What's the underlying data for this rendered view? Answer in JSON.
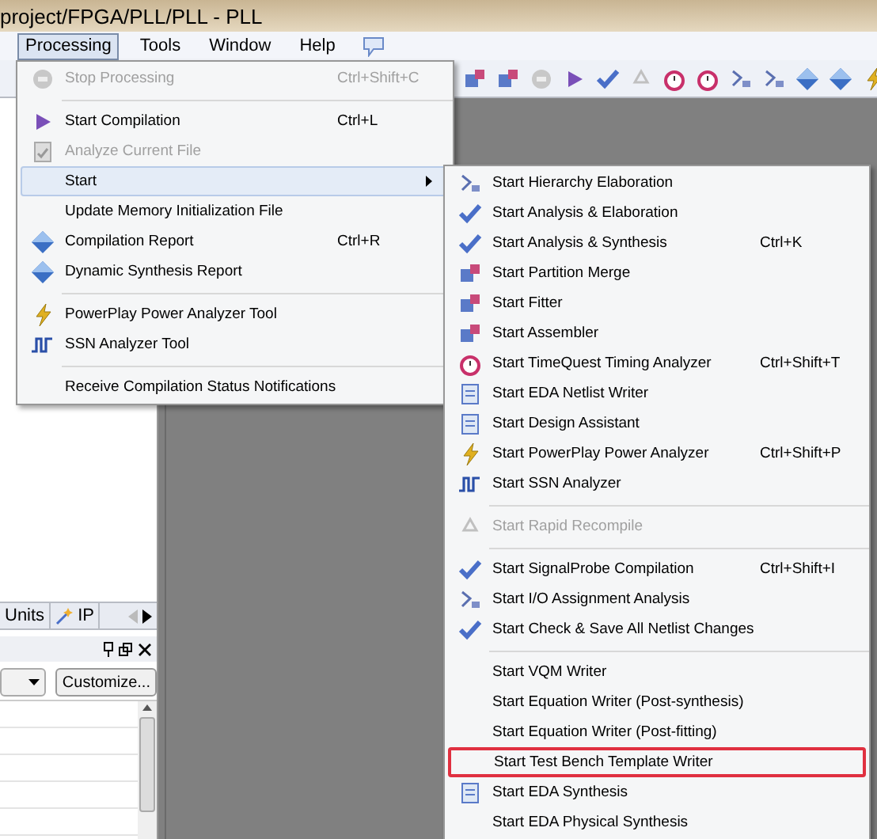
{
  "window": {
    "title": "project/FPGA/PLL/PLL - PLL"
  },
  "menubar": [
    {
      "label": "Processing",
      "selected": true
    },
    {
      "label": "Tools",
      "selected": false
    },
    {
      "label": "Window",
      "selected": false
    },
    {
      "label": "Help",
      "selected": false
    }
  ],
  "processing_menu": [
    {
      "kind": "item",
      "label": "Stop Processing",
      "shortcut": "Ctrl+Shift+C",
      "disabled": true,
      "selected": false
    },
    {
      "kind": "separator"
    },
    {
      "kind": "item",
      "label": "Start Compilation",
      "shortcut": "Ctrl+L",
      "disabled": false,
      "selected": false
    },
    {
      "kind": "item",
      "label": "Analyze Current File",
      "disabled": true,
      "selected": false
    },
    {
      "kind": "submenu",
      "label": "Start",
      "disabled": false,
      "selected": true
    },
    {
      "kind": "item",
      "label": "Update Memory Initialization File",
      "disabled": false,
      "selected": false
    },
    {
      "kind": "item",
      "label": "Compilation Report",
      "shortcut": "Ctrl+R",
      "disabled": false,
      "selected": false
    },
    {
      "kind": "item",
      "label": "Dynamic Synthesis Report",
      "disabled": false,
      "selected": false
    },
    {
      "kind": "separator"
    },
    {
      "kind": "item",
      "label": "PowerPlay Power Analyzer Tool",
      "disabled": false,
      "selected": false
    },
    {
      "kind": "item",
      "label": "SSN Analyzer Tool",
      "disabled": false,
      "selected": false
    },
    {
      "kind": "separator"
    },
    {
      "kind": "item",
      "label": "Receive Compilation Status Notifications",
      "disabled": false,
      "selected": false
    }
  ],
  "start_submenu": [
    {
      "kind": "item",
      "label": "Start Hierarchy Elaboration",
      "disabled": false,
      "marked": false
    },
    {
      "kind": "item",
      "label": "Start Analysis & Elaboration",
      "disabled": false,
      "marked": false
    },
    {
      "kind": "item",
      "label": "Start Analysis & Synthesis",
      "shortcut": "Ctrl+K",
      "disabled": false,
      "marked": false
    },
    {
      "kind": "item",
      "label": "Start Partition Merge",
      "disabled": false,
      "marked": false
    },
    {
      "kind": "item",
      "label": "Start Fitter",
      "disabled": false,
      "marked": false
    },
    {
      "kind": "item",
      "label": "Start Assembler",
      "disabled": false,
      "marked": false
    },
    {
      "kind": "item",
      "label": "Start TimeQuest Timing Analyzer",
      "shortcut": "Ctrl+Shift+T",
      "disabled": false,
      "marked": false
    },
    {
      "kind": "item",
      "label": "Start EDA Netlist Writer",
      "disabled": false,
      "marked": false
    },
    {
      "kind": "item",
      "label": "Start Design Assistant",
      "disabled": false,
      "marked": false
    },
    {
      "kind": "item",
      "label": "Start PowerPlay Power Analyzer",
      "shortcut": "Ctrl+Shift+P",
      "disabled": false,
      "marked": false
    },
    {
      "kind": "item",
      "label": "Start SSN Analyzer",
      "disabled": false,
      "marked": false
    },
    {
      "kind": "separator"
    },
    {
      "kind": "item",
      "label": "Start Rapid Recompile",
      "disabled": true,
      "marked": false
    },
    {
      "kind": "separator"
    },
    {
      "kind": "item",
      "label": "Start SignalProbe Compilation",
      "shortcut": "Ctrl+Shift+I",
      "disabled": false,
      "marked": false
    },
    {
      "kind": "item",
      "label": "Start I/O Assignment Analysis",
      "disabled": false,
      "marked": false
    },
    {
      "kind": "item",
      "label": "Start Check & Save All Netlist Changes",
      "disabled": false,
      "marked": false
    },
    {
      "kind": "separator"
    },
    {
      "kind": "item",
      "label": "Start VQM Writer",
      "disabled": false,
      "marked": false
    },
    {
      "kind": "item",
      "label": "Start Equation Writer (Post-synthesis)",
      "disabled": false,
      "marked": false
    },
    {
      "kind": "item",
      "label": "Start Equation Writer (Post-fitting)",
      "disabled": false,
      "marked": false
    },
    {
      "kind": "item",
      "label": "Start Test Bench Template Writer",
      "disabled": false,
      "marked": true
    },
    {
      "kind": "item",
      "label": "Start EDA Synthesis",
      "disabled": false,
      "marked": false
    },
    {
      "kind": "item",
      "label": "Start EDA Physical Synthesis",
      "disabled": false,
      "marked": false
    }
  ],
  "left_panel": {
    "tabs": [
      {
        "label": "Units",
        "selected": false
      },
      {
        "label": "IP",
        "selected": false
      }
    ],
    "customize_button": "Customize..."
  }
}
